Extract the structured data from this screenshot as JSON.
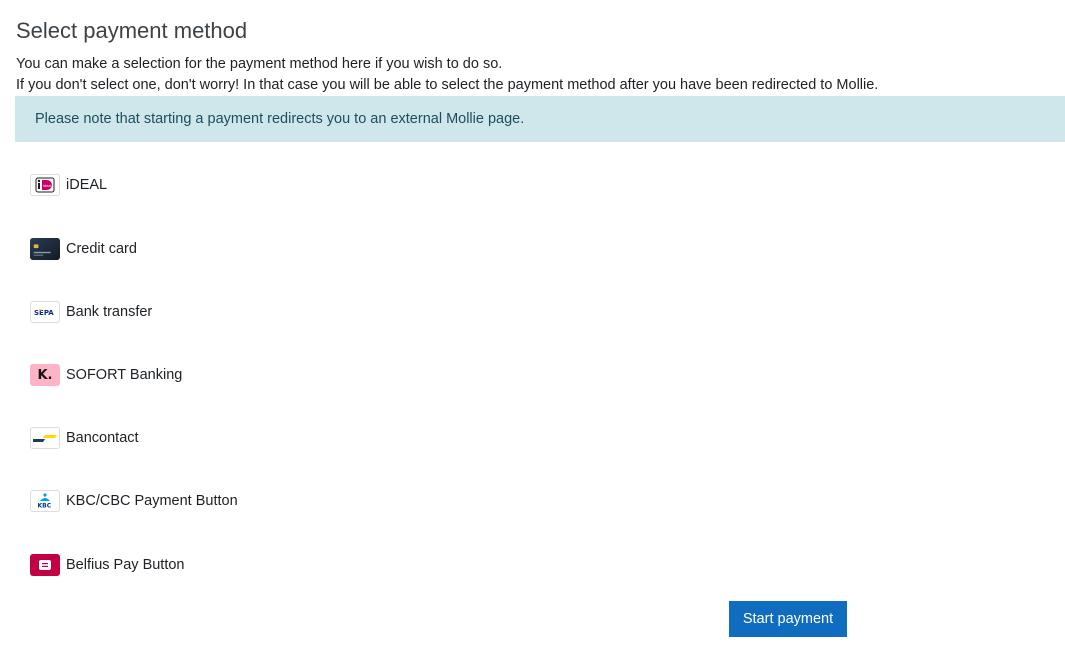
{
  "title": "Select payment method",
  "intro": {
    "line1": "You can make a selection for the payment method here if you wish to do so.",
    "line2": "If you don't select one, don't worry! In that case you will be able to select the payment method after you have been redirected to Mollie."
  },
  "notice": "Please note that starting a payment redirects you to an external Mollie page.",
  "methods": [
    {
      "label": "iDEAL",
      "icon": "ideal-icon"
    },
    {
      "label": "Credit card",
      "icon": "credit-card-icon"
    },
    {
      "label": "Bank transfer",
      "icon": "sepa-icon"
    },
    {
      "label": "SOFORT Banking",
      "icon": "klarna-sofort-icon"
    },
    {
      "label": "Bancontact",
      "icon": "bancontact-icon"
    },
    {
      "label": "KBC/CBC Payment Button",
      "icon": "kbc-icon"
    },
    {
      "label": "Belfius Pay Button",
      "icon": "belfius-icon"
    }
  ],
  "icon_text": {
    "sepa": "SEPA",
    "kbc": "KBC",
    "klarna": "K."
  },
  "start_button": "Start payment",
  "colors": {
    "button": "#0f6cbf",
    "notice_bg": "#cfe6ea",
    "notice_text": "#1c4f5c"
  }
}
